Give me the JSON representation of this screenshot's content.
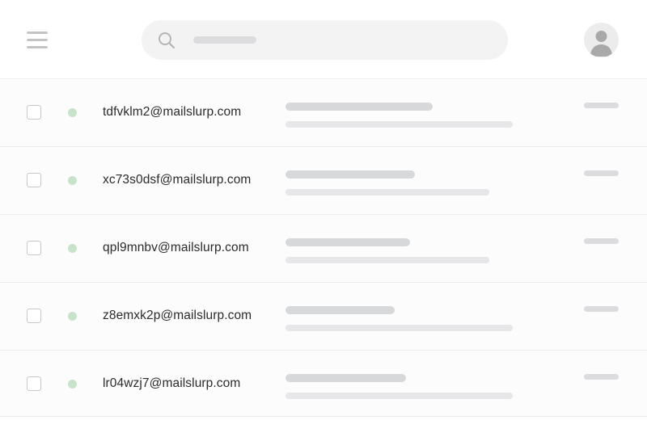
{
  "header": {
    "menu_icon": "hamburger-menu-icon",
    "search_icon": "search-icon",
    "avatar_icon": "user-avatar-icon"
  },
  "inbox": {
    "rows": [
      {
        "email": "tdfvklm2@mailslurp.com"
      },
      {
        "email": "xc73s0dsf@mailslurp.com"
      },
      {
        "email": "qpl9mnbv@mailslurp.com"
      },
      {
        "email": "z8emxk2p@mailslurp.com"
      },
      {
        "email": "lr04wzj7@mailslurp.com"
      }
    ]
  },
  "colors": {
    "status_dot": "#c9e3cb",
    "skeleton_dark": "#d7d8da",
    "skeleton_light": "#e7e7e9",
    "search_bg": "#f3f3f4"
  }
}
